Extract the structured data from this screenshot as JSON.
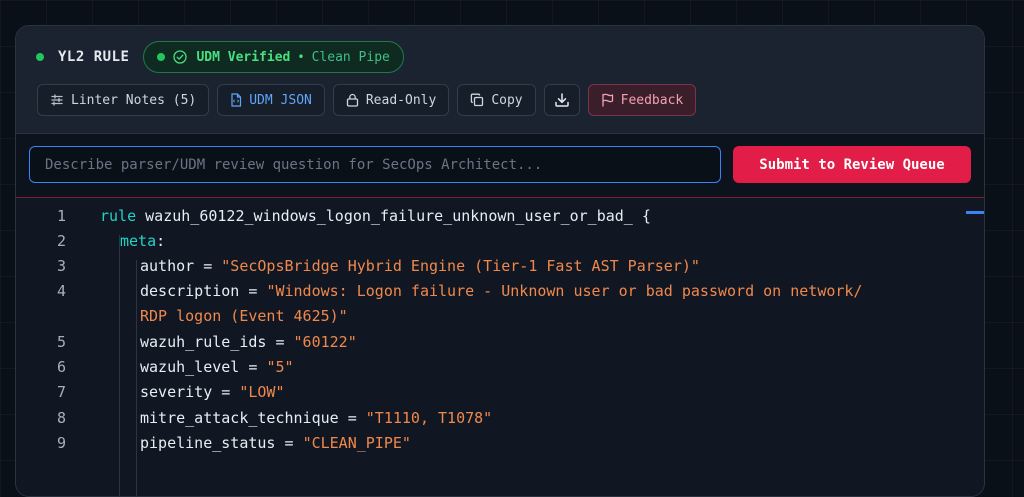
{
  "header": {
    "title": "YL2 RULE",
    "badge_label": "UDM Verified",
    "badge_separator": "•",
    "badge_sub": "Clean Pipe"
  },
  "toolbar": {
    "linter_label": "Linter Notes (5)",
    "udm_json_label": "UDM JSON",
    "readonly_label": "Read-Only",
    "copy_label": "Copy",
    "feedback_label": "Feedback"
  },
  "query": {
    "placeholder": "Describe parser/UDM review question for SecOps Architect...",
    "submit_label": "Submit to Review Queue"
  },
  "code": {
    "lines": [
      {
        "num": "1",
        "kw": "rule",
        "text": " wazuh_60122_windows_logon_failure_unknown_user_or_bad_ {"
      },
      {
        "num": "2",
        "kw": "meta",
        "text": ":"
      },
      {
        "num": "3",
        "key": "author = ",
        "val": "\"SecOpsBridge Hybrid Engine (Tier-1 Fast AST Parser)\""
      },
      {
        "num": "4",
        "key": "description = ",
        "val": "\"Windows: Logon failure - Unknown user or bad password on network/"
      },
      {
        "num": "",
        "val": "RDP logon (Event 4625)\""
      },
      {
        "num": "5",
        "key": "wazuh_rule_ids = ",
        "val": "\"60122\""
      },
      {
        "num": "6",
        "key": "wazuh_level = ",
        "val": "\"5\""
      },
      {
        "num": "7",
        "key": "severity = ",
        "val": "\"LOW\""
      },
      {
        "num": "8",
        "key": "mitre_attack_technique = ",
        "val": "\"T1110, T1078\""
      },
      {
        "num": "9",
        "key": "pipeline_status = ",
        "val": "\"CLEAN_PIPE\""
      }
    ]
  },
  "colors": {
    "accent_green": "#22c55e",
    "accent_blue": "#3b82f6",
    "submit_red": "#e11d48",
    "keyword": "#22d3c5",
    "string": "#f0884c"
  }
}
